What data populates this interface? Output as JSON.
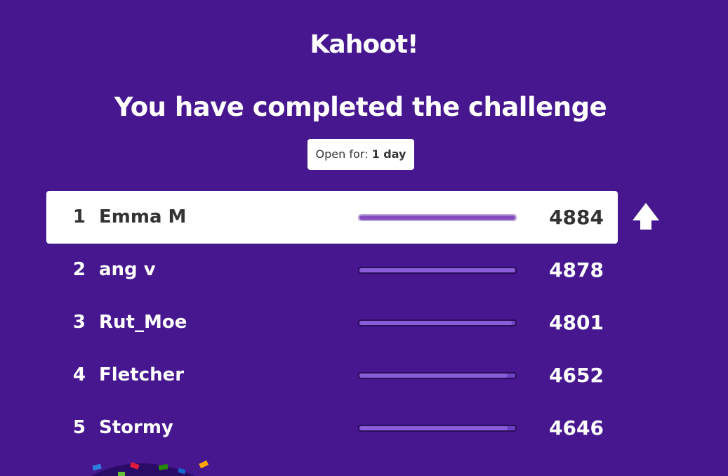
{
  "app": {
    "logo_text": "Kahoot!"
  },
  "header": {
    "title": "You have completed the challenge",
    "open_label": "Open for:",
    "open_value": "1 day"
  },
  "leaderboard": {
    "rows": [
      {
        "rank": "1",
        "name": "Emma M",
        "score": "4884",
        "progress": 1.0,
        "highlighted": true
      },
      {
        "rank": "2",
        "name": "ang v",
        "score": "4878",
        "progress": 0.9988
      },
      {
        "rank": "3",
        "name": "Rut_Moe",
        "score": "4801",
        "progress": 0.983
      },
      {
        "rank": "4",
        "name": "Fletcher",
        "score": "4652",
        "progress": 0.9525
      },
      {
        "rank": "5",
        "name": "Stormy",
        "score": "4646",
        "progress": 0.9513
      }
    ]
  },
  "icons": {
    "rank_change": "arrow-up-icon",
    "decoration": "confetti-icon"
  },
  "colors": {
    "background": "#46178f",
    "highlight_row": "#ffffff",
    "bar_fill": "#864cbf"
  }
}
